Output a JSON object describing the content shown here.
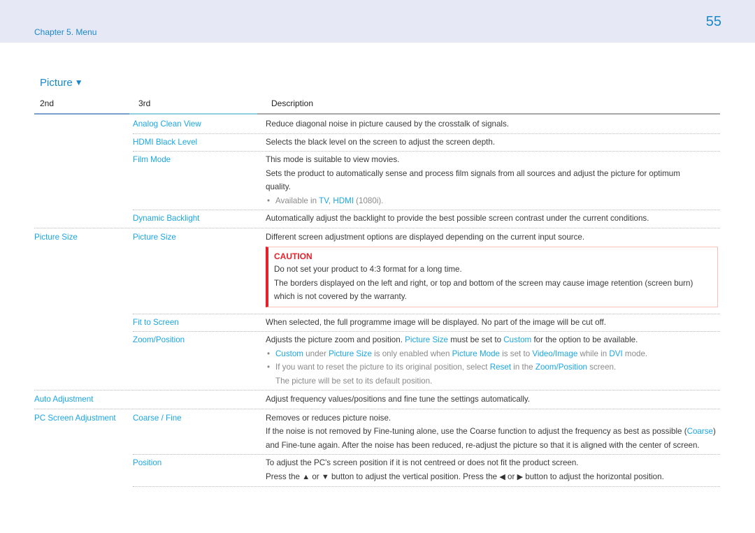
{
  "header": {
    "chapter": "Chapter 5. Menu",
    "page_number": "55"
  },
  "section": {
    "title": "Picture",
    "icon": "triangle-down-icon",
    "glyph": "▼"
  },
  "table": {
    "columns": [
      "2nd",
      "3rd",
      "Description"
    ],
    "rows": {
      "analog": {
        "third": "Analog Clean View",
        "desc": "Reduce diagonal noise in picture caused by the crosstalk of signals."
      },
      "hdmi_black": {
        "third": "HDMI Black Level",
        "desc": "Selects the black level on the screen to adjust the screen depth."
      },
      "film": {
        "third": "Film Mode",
        "desc1": "This mode is suitable to view movies.",
        "desc2": "Sets the product to automatically sense and process film signals from all sources and adjust the picture for optimum quality.",
        "bullet_pre": "Available in ",
        "bullet_tv": "TV",
        "bullet_comma": ", ",
        "bullet_hdmi": "HDMI",
        "bullet_post": " (1080i)."
      },
      "backlight": {
        "third": "Dynamic Backlight",
        "desc": "Automatically adjust the backlight to provide the best possible screen contrast under the current conditions."
      },
      "picture_size": {
        "second": "Picture Size",
        "third": "Picture Size",
        "desc": "Different screen adjustment options are displayed depending on the current input source.",
        "caution_title": "CAUTION",
        "caution_1": "Do not set your product to 4:3 format for a long time.",
        "caution_2": "The borders displayed on the left and right, or top and bottom of the screen may cause image retention (screen burn) which is not covered by the warranty."
      },
      "fit": {
        "third": "Fit to Screen",
        "desc": "When selected, the full programme image will be displayed. No part of the image will be cut off."
      },
      "zoom": {
        "third": "Zoom/Position",
        "d_a": "Adjusts the picture zoom and position. ",
        "d_b": "Picture Size",
        "d_c": " must be set to ",
        "d_d": "Custom",
        "d_e": " for the option to be available.",
        "b1_a": "Custom",
        "b1_b": " under ",
        "b1_c": "Picture Size",
        "b1_d": " is only enabled when ",
        "b1_e": "Picture Mode",
        "b1_f": " is set to ",
        "b1_g": "Video/Image",
        "b1_h": " while in ",
        "b1_i": "DVI",
        "b1_j": " mode.",
        "b2_a": "If you want to reset the picture to its original position, select ",
        "b2_b": "Reset",
        "b2_c": " in the ",
        "b2_d": "Zoom/Position",
        "b2_e": " screen.",
        "b2_f": "The picture will be set to its default position."
      },
      "auto": {
        "second": "Auto Adjustment",
        "desc": "Adjust frequency values/positions and fine tune the settings automatically."
      },
      "coarse": {
        "second": "PC Screen Adjustment",
        "third": "Coarse / Fine",
        "desc1": "Removes or reduces picture noise.",
        "desc2_a": "If the noise is not removed by Fine-tuning alone, use the Coarse function to adjust the frequency as best as possible (",
        "desc2_b": "Coarse",
        "desc2_c": ") and Fine-tune again. After the noise has been reduced, re-adjust the picture so that it is aligned with the center of screen."
      },
      "position": {
        "third": "Position",
        "desc1": "To adjust the PC's screen position if it is not centreed or does not fit the product screen.",
        "desc2_a": "Press the ",
        "up": "▲",
        "desc2_b": " or ",
        "down": "▼",
        "desc2_c": " button to adjust the vertical position. Press the ",
        "left": "◀",
        "desc2_d": " or ",
        "right": "▶",
        "desc2_e": " button to adjust the horizontal position."
      }
    }
  },
  "colors": {
    "accent": "#1a88cc",
    "link": "#1aa6e6",
    "caution": "#e8202a",
    "band": "#e6e9f5"
  }
}
